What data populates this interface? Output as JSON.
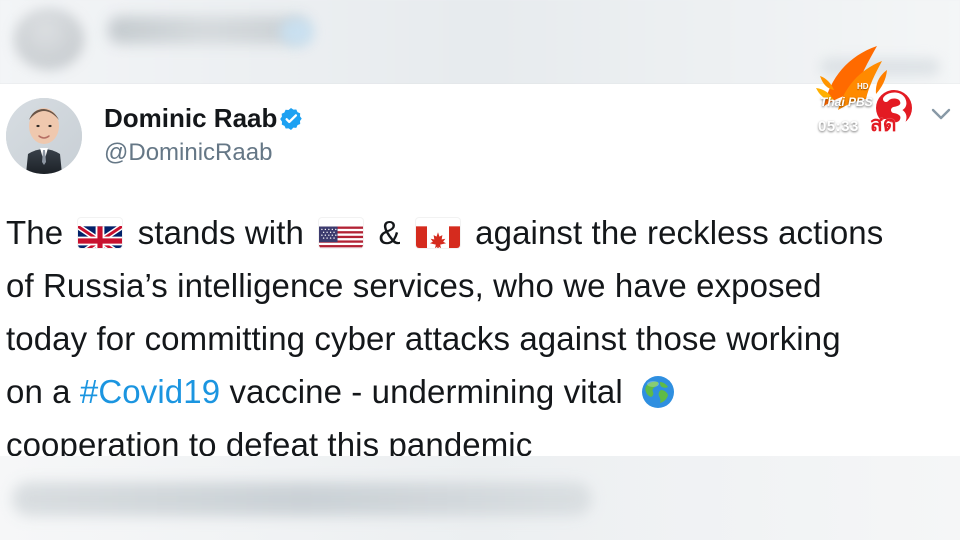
{
  "tweet": {
    "author_name": "Dominic Raab",
    "author_handle": "@DominicRaab",
    "verified_badge": "verified-icon",
    "menu_icon": "chevron-down-icon",
    "lines": [
      [
        "The",
        "stands with",
        "&",
        "against the reckless actions"
      ],
      [
        "of Russia’s intelligence services, who we have exposed"
      ],
      [
        "today for committing cyber attacks against those working"
      ],
      [
        "on a",
        "#Covid19",
        "vaccine - undermining vital"
      ],
      [
        "cooperation to defeat this pandemic"
      ]
    ],
    "emoji": {
      "uk": "uk-flag-icon",
      "us": "us-flag-icon",
      "ca": "canada-flag-icon",
      "globe": "globe-icon"
    }
  },
  "overlay": {
    "brand": "Thai PBS",
    "hd": "HD",
    "channel_number": "3",
    "time": "05:33",
    "live": "สด"
  },
  "colors": {
    "text_primary": "#14171a",
    "text_secondary": "#657786",
    "link": "#1b95e0",
    "verified": "#1da1f2",
    "logo_orange": "#ff6a00",
    "logo_red": "#e31b23"
  }
}
